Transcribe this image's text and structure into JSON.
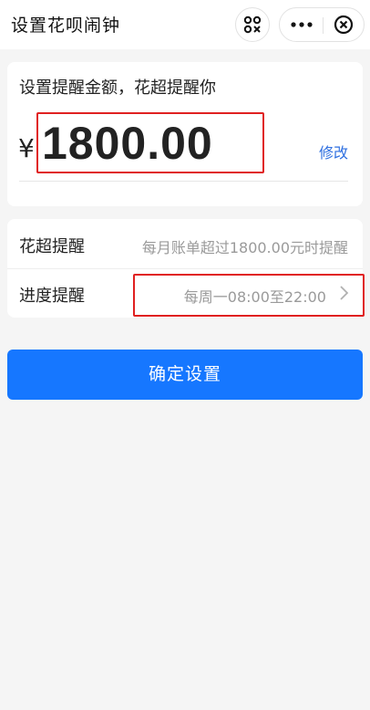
{
  "header": {
    "title": "设置花呗闹钟",
    "icons": [
      "scan-icon",
      "more-icon",
      "close-icon"
    ]
  },
  "amount_card": {
    "hint": "设置提醒金额，花超提醒你",
    "currency": "¥",
    "amount": "1800.00",
    "edit_label": "修改"
  },
  "settings": {
    "rows": [
      {
        "label": "花超提醒",
        "value": "每月账单超过1800.00元时提醒"
      },
      {
        "label": "进度提醒",
        "value": "每周一08:00至22:00"
      }
    ]
  },
  "confirm_button": {
    "label": "确定设置"
  },
  "colors": {
    "accent": "#1677ff",
    "link": "#2e6fe0",
    "highlight": "#e02020",
    "background": "#f5f5f5"
  }
}
